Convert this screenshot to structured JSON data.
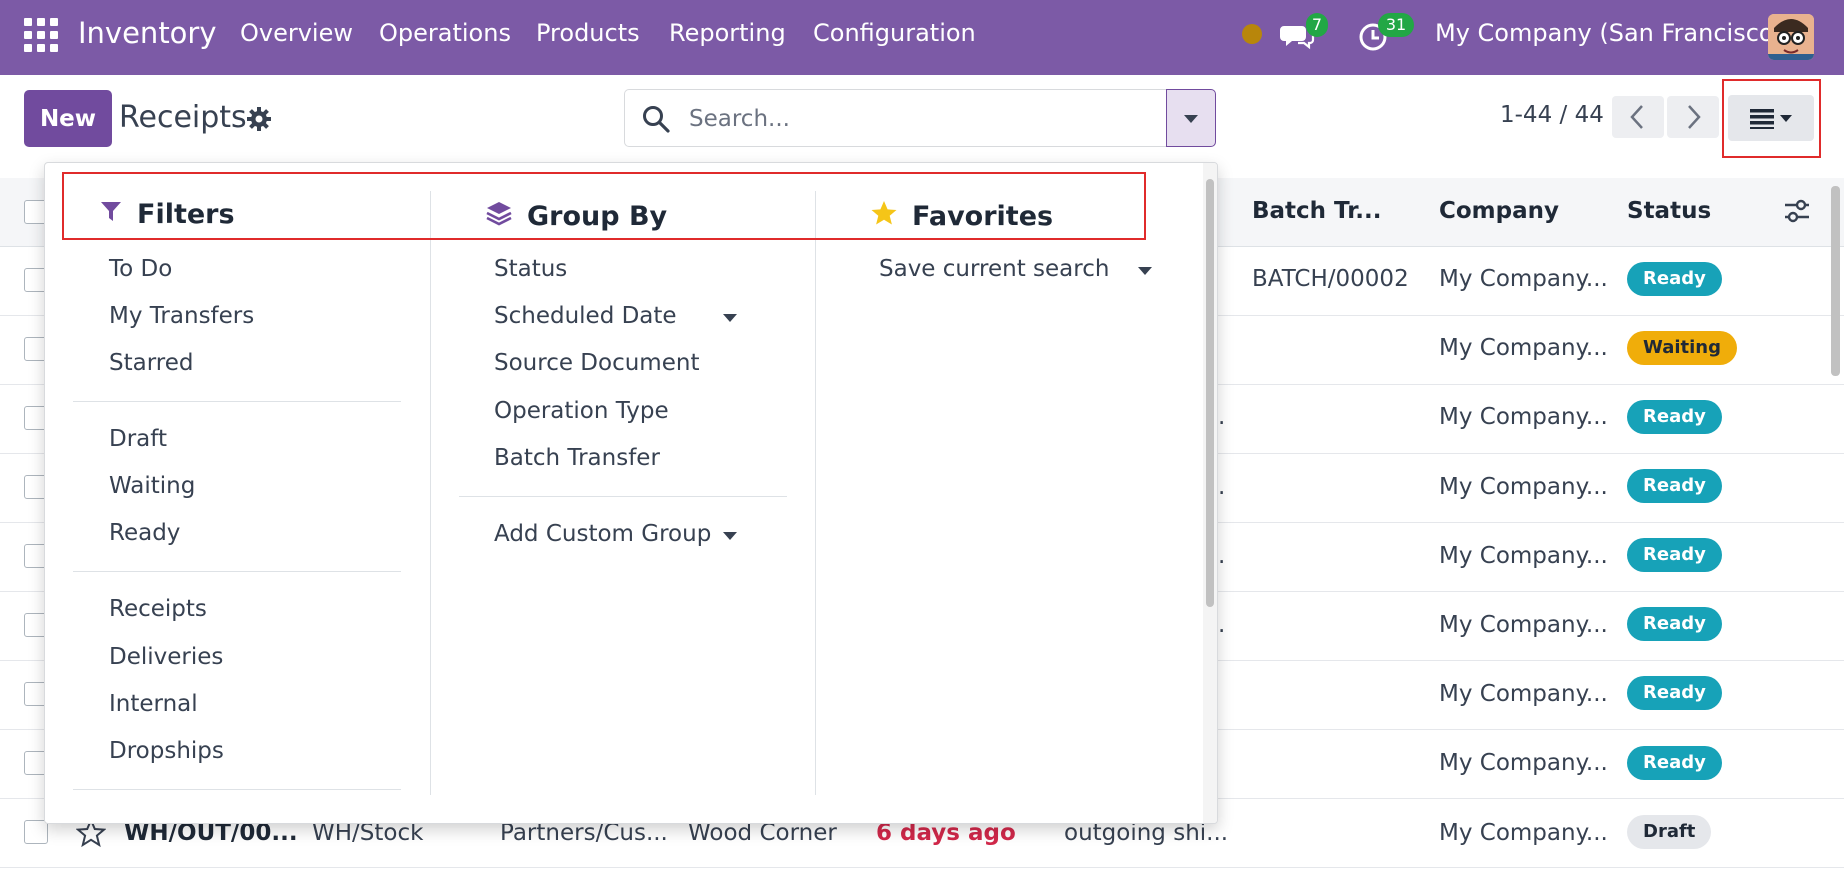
{
  "nav": {
    "app_name": "Inventory",
    "menu": [
      "Overview",
      "Operations",
      "Products",
      "Reporting",
      "Configuration"
    ],
    "chat_count": "7",
    "activity_count": "31",
    "company": "My Company (San Francisco)",
    "brand_color": "#7c5aa6"
  },
  "control": {
    "new_label": "New",
    "title": "Receipts",
    "search_placeholder": "Search...",
    "pager": "1-44 / 44"
  },
  "list": {
    "headers": {
      "batch": "Batch Tr...",
      "company": "Company",
      "status": "Status"
    },
    "rows": [
      {
        "batch": "BATCH/00002",
        "company": "My Company...",
        "status": "Ready"
      },
      {
        "company": "My Company...",
        "status": "Waiting"
      },
      {
        "ellipsis": ".",
        "company": "My Company...",
        "status": "Ready"
      },
      {
        "ellipsis": ".",
        "company": "My Company...",
        "status": "Ready"
      },
      {
        "ellipsis": ".",
        "company": "My Company...",
        "status": "Ready"
      },
      {
        "ellipsis": ".",
        "company": "My Company...",
        "status": "Ready"
      },
      {
        "company": "My Company...",
        "status": "Ready"
      },
      {
        "company": "My Company...",
        "status": "Ready"
      },
      {
        "reference": "WH/OUT/00...",
        "from": "WH/Stock",
        "to": "Partners/Cus...",
        "contact": "Wood Corner",
        "scheduled": "6 days ago",
        "source": "outgoing shi...",
        "company": "My Company...",
        "status": "Draft"
      }
    ]
  },
  "dropdown": {
    "filters": {
      "title": "Filters",
      "group1": [
        "To Do",
        "My Transfers",
        "Starred"
      ],
      "group2": [
        "Draft",
        "Waiting",
        "Ready"
      ],
      "group3": [
        "Receipts",
        "Deliveries",
        "Internal",
        "Dropships"
      ]
    },
    "group_by": {
      "title": "Group By",
      "items": [
        "Status",
        "Scheduled Date",
        "Source Document",
        "Operation Type",
        "Batch Transfer"
      ],
      "custom": "Add Custom Group"
    },
    "favorites": {
      "title": "Favorites",
      "save": "Save current search"
    }
  },
  "colors": {
    "primary": "#714b9e",
    "ready": "#17a2b8",
    "waiting": "#f0ad0a",
    "overdue": "#d1284a",
    "highlight": "#e02b2b"
  },
  "icons": [
    "apps-grid-icon",
    "chat-icon",
    "clock-icon",
    "gear-icon",
    "search-icon",
    "chevron-left-icon",
    "chevron-right-icon",
    "list-view-icon",
    "funnel-icon",
    "layers-icon",
    "star-icon",
    "sliders-icon"
  ]
}
